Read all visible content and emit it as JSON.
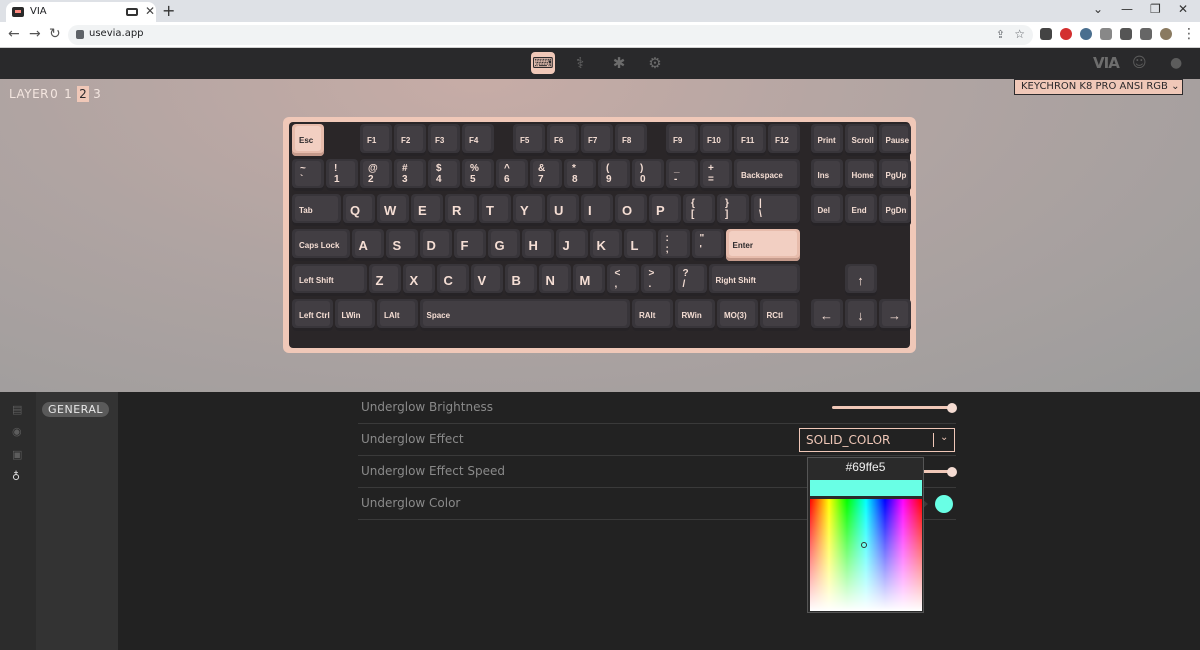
{
  "browser": {
    "tab_title": "VIA",
    "url": "usevia.app",
    "new_tab": "+",
    "close_tab": "✕",
    "window_controls": {
      "chevron": "⌄",
      "minimize": "—",
      "restore": "❐",
      "close": "✕"
    },
    "nav": {
      "back": "←",
      "forward": "→",
      "reload": "↻"
    }
  },
  "app": {
    "logo": "VIA",
    "top_icons": [
      "keyboard-icon",
      "stethoscope-icon",
      "bug-icon",
      "gear-icon"
    ],
    "keyboard_name": "KEYCHRON K8 PRO ANSI RGB"
  },
  "layers": {
    "label": "LAYER",
    "items": [
      "0",
      "1",
      "2",
      "3"
    ],
    "selected": "2"
  },
  "keys": [
    {
      "k": "Esc",
      "c": "mid"
    },
    {
      "k": "F1",
      "c": "mid"
    },
    {
      "k": "F2",
      "c": "mid"
    },
    {
      "k": "F3",
      "c": "mid"
    },
    {
      "k": "F4",
      "c": "mid"
    },
    {
      "k": "F5",
      "c": "mid"
    },
    {
      "k": "F6",
      "c": "mid"
    },
    {
      "k": "F7",
      "c": "mid"
    },
    {
      "k": "F8",
      "c": "mid"
    },
    {
      "k": "F9",
      "c": "mid"
    },
    {
      "k": "F10",
      "c": "mid"
    },
    {
      "k": "F11",
      "c": "mid"
    },
    {
      "k": "F12",
      "c": "mid"
    },
    {
      "k": "Print",
      "c": "mid"
    },
    {
      "k": "Scroll",
      "c": "mid"
    },
    {
      "k": "Pause",
      "c": "mid"
    },
    {
      "t": "~",
      "b": "`"
    },
    {
      "t": "!",
      "b": "1"
    },
    {
      "t": "@",
      "b": "2"
    },
    {
      "t": "#",
      "b": "3"
    },
    {
      "t": "$",
      "b": "4"
    },
    {
      "t": "%",
      "b": "5"
    },
    {
      "t": "^",
      "b": "6"
    },
    {
      "t": "&",
      "b": "7"
    },
    {
      "t": "*",
      "b": "8"
    },
    {
      "t": "(",
      "b": "9"
    },
    {
      "t": ")",
      "b": "0"
    },
    {
      "t": "_",
      "b": "-"
    },
    {
      "t": "+",
      "b": "="
    },
    {
      "k": "Backspace",
      "c": "mid"
    },
    {
      "k": "Ins",
      "c": "mid"
    },
    {
      "k": "Home",
      "c": "mid"
    },
    {
      "k": "PgUp",
      "c": "mid"
    },
    {
      "k": "Tab",
      "c": "mid"
    },
    {
      "k": "Q",
      "c": "big"
    },
    {
      "k": "W",
      "c": "big"
    },
    {
      "k": "E",
      "c": "big"
    },
    {
      "k": "R",
      "c": "big"
    },
    {
      "k": "T",
      "c": "big"
    },
    {
      "k": "Y",
      "c": "big"
    },
    {
      "k": "U",
      "c": "big"
    },
    {
      "k": "I",
      "c": "big"
    },
    {
      "k": "O",
      "c": "big"
    },
    {
      "k": "P",
      "c": "big"
    },
    {
      "t": "{",
      "b": "["
    },
    {
      "t": "}",
      "b": "]"
    },
    {
      "t": "|",
      "b": "\\"
    },
    {
      "k": "Del",
      "c": "mid"
    },
    {
      "k": "End",
      "c": "mid"
    },
    {
      "k": "PgDn",
      "c": "mid"
    },
    {
      "k": "Caps Lock",
      "c": "mid"
    },
    {
      "k": "A",
      "c": "big"
    },
    {
      "k": "S",
      "c": "big"
    },
    {
      "k": "D",
      "c": "big"
    },
    {
      "k": "F",
      "c": "big"
    },
    {
      "k": "G",
      "c": "big"
    },
    {
      "k": "H",
      "c": "big"
    },
    {
      "k": "J",
      "c": "big"
    },
    {
      "k": "K",
      "c": "big"
    },
    {
      "k": "L",
      "c": "big"
    },
    {
      "t": ":",
      "b": ";"
    },
    {
      "t": "\"",
      "b": "'"
    },
    {
      "k": "Enter",
      "c": "mid"
    },
    {
      "k": "Left Shift",
      "c": "mid"
    },
    {
      "k": "Z",
      "c": "big"
    },
    {
      "k": "X",
      "c": "big"
    },
    {
      "k": "C",
      "c": "big"
    },
    {
      "k": "V",
      "c": "big"
    },
    {
      "k": "B",
      "c": "big"
    },
    {
      "k": "N",
      "c": "big"
    },
    {
      "k": "M",
      "c": "big"
    },
    {
      "t": "<",
      "b": ","
    },
    {
      "t": ">",
      "b": "."
    },
    {
      "t": "?",
      "b": "/"
    },
    {
      "k": "Right Shift",
      "c": "mid"
    },
    {
      "k": "↑",
      "c": "ctr"
    },
    {
      "k": "Left Ctrl",
      "c": "mid"
    },
    {
      "k": "LWin",
      "c": "mid"
    },
    {
      "k": "LAlt",
      "c": "mid"
    },
    {
      "k": "Space",
      "c": "mid"
    },
    {
      "k": "RAlt",
      "c": "mid"
    },
    {
      "k": "RWin",
      "c": "mid"
    },
    {
      "k": "MO(3)",
      "c": "mid"
    },
    {
      "k": "RCtl",
      "c": "mid"
    },
    {
      "k": "←",
      "c": "ctr"
    },
    {
      "k": "↓",
      "c": "ctr"
    },
    {
      "k": "→",
      "c": "ctr"
    }
  ],
  "sidebar": {
    "icons": [
      "keycap-icon",
      "record-icon",
      "save-icon",
      "lightbulb-icon"
    ],
    "active": "lightbulb-icon"
  },
  "menu": {
    "general": "GENERAL"
  },
  "settings": {
    "brightness_label": "Underglow Brightness",
    "brightness_value": 1.0,
    "effect_label": "Underglow Effect",
    "effect_value": "SOLID_COLOR",
    "speed_label": "Underglow Effect Speed",
    "speed_value": 1.0,
    "color_label": "Underglow Color",
    "color_value": "#69ffe5"
  },
  "picker": {
    "hex": "#69ffe5"
  },
  "colors": {
    "accent": "#f0c8b8",
    "keycap": "#423e43",
    "case": "#2a2628",
    "underglow": "#69ffe5"
  }
}
